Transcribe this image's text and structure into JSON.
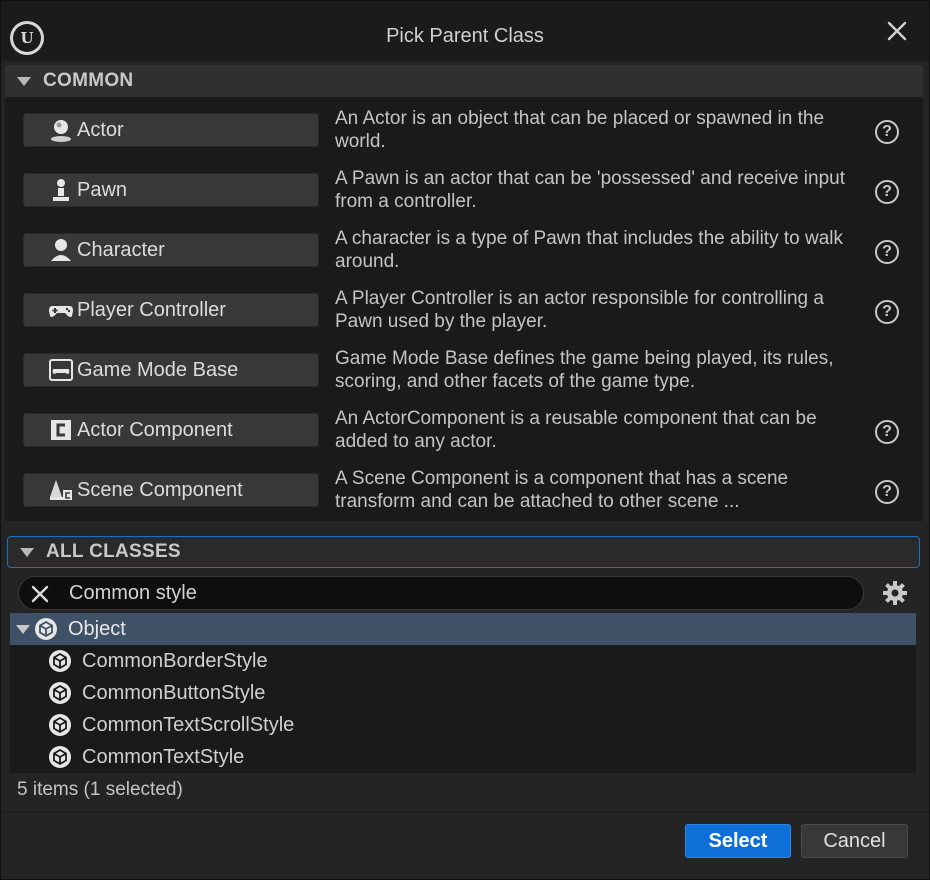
{
  "window": {
    "title": "Pick Parent Class",
    "logo_icon": "unreal-engine-logo-icon",
    "close_icon": "close-icon"
  },
  "common": {
    "header": "COMMON",
    "classes": [
      {
        "label": "Actor",
        "icon": "actor-sphere-icon",
        "description": "An Actor is an object that can be placed or spawned in the world."
      },
      {
        "label": "Pawn",
        "icon": "pawn-icon",
        "description": "A Pawn is an actor that can be 'possessed' and receive input from a controller."
      },
      {
        "label": "Character",
        "icon": "character-bust-icon",
        "description": "A character is a type of Pawn that includes the ability to walk around."
      },
      {
        "label": "Player Controller",
        "icon": "gamepad-icon",
        "description": "A Player Controller is an actor responsible for controlling a Pawn used by the player."
      },
      {
        "label": "Game Mode Base",
        "icon": "game-mode-icon",
        "description": "Game Mode Base defines the game being played, its rules, scoring, and other facets of the game type."
      },
      {
        "label": "Actor Component",
        "icon": "actor-component-icon",
        "description": "An ActorComponent is a reusable component that can be added to any actor."
      },
      {
        "label": "Scene Component",
        "icon": "scene-component-icon",
        "description": "A Scene Component is a component that has a scene transform and can be attached to other scene ..."
      }
    ]
  },
  "all_classes": {
    "header": "ALL CLASSES",
    "search": {
      "value": "Common style",
      "placeholder": ""
    },
    "tree": {
      "root": "Object",
      "children": [
        "CommonBorderStyle",
        "CommonButtonStyle",
        "CommonTextScrollStyle",
        "CommonTextStyle"
      ]
    },
    "status": "5 items (1 selected)"
  },
  "footer": {
    "select_label": "Select",
    "cancel_label": "Cancel"
  },
  "colors": {
    "accent": "#0f6fd8",
    "selected_row": "#3f5166",
    "focus_border": "#1f6fbf"
  }
}
